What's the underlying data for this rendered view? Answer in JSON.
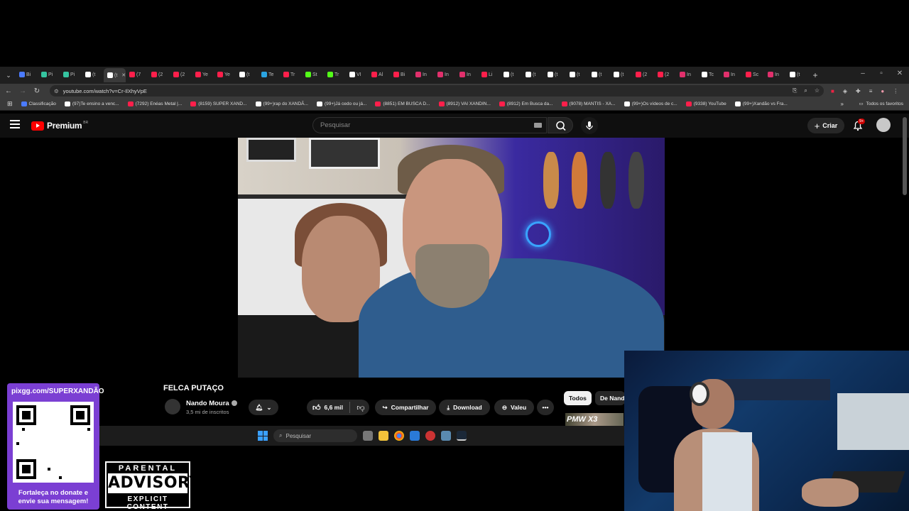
{
  "browser": {
    "tabs": [
      {
        "label": "Bi",
        "color": "#4b7bff"
      },
      {
        "label": "Pi",
        "color": "#35c4a0"
      },
      {
        "label": "Pi",
        "color": "#35c4a0"
      },
      {
        "label": "(t",
        "color": "#ffffff"
      },
      {
        "label": "(t",
        "color": "#ffffff",
        "active": true
      },
      {
        "label": "(7",
        "color": "#ff1f4b"
      },
      {
        "label": "(2",
        "color": "#ff1f4b"
      },
      {
        "label": "(2",
        "color": "#ff1f4b"
      },
      {
        "label": "Ye",
        "color": "#ff1f4b"
      },
      {
        "label": "Ye",
        "color": "#ff1f4b"
      },
      {
        "label": "(t",
        "color": "#ffffff"
      },
      {
        "label": "Te",
        "color": "#2aa3e0"
      },
      {
        "label": "Tr",
        "color": "#ff1f4b"
      },
      {
        "label": "St",
        "color": "#53fc18"
      },
      {
        "label": "Tr",
        "color": "#53fc18"
      },
      {
        "label": "VI",
        "color": "#ffffff"
      },
      {
        "label": "Al",
        "color": "#ff1f4b"
      },
      {
        "label": "Bi",
        "color": "#ff1f4b"
      },
      {
        "label": "In",
        "color": "#e1306c"
      },
      {
        "label": "In",
        "color": "#e1306c"
      },
      {
        "label": "In",
        "color": "#e1306c"
      },
      {
        "label": "Li",
        "color": "#ff1f4b"
      },
      {
        "label": "(t",
        "color": "#ffffff"
      },
      {
        "label": "(t",
        "color": "#ffffff"
      },
      {
        "label": "(t",
        "color": "#ffffff"
      },
      {
        "label": "(t",
        "color": "#ffffff"
      },
      {
        "label": "(t",
        "color": "#ffffff"
      },
      {
        "label": "(t",
        "color": "#ffffff"
      },
      {
        "label": "(2",
        "color": "#ff1f4b"
      },
      {
        "label": "(2",
        "color": "#ff1f4b"
      },
      {
        "label": "In",
        "color": "#e1306c"
      },
      {
        "label": "Tc",
        "color": "#ffffff"
      },
      {
        "label": "In",
        "color": "#e1306c"
      },
      {
        "label": "Sc",
        "color": "#ff1f4b"
      },
      {
        "label": "In",
        "color": "#e1306c"
      },
      {
        "label": "(t",
        "color": "#ffffff"
      }
    ],
    "url": "youtube.com/watch?v=Cr-IlXhyVpE",
    "bookmarks": [
      {
        "label": "Classificação",
        "color": "#4b7bff"
      },
      {
        "label": "(97)Te ensino a venc...",
        "color": "#ffffff"
      },
      {
        "label": "(7292) Enéas Metal |...",
        "color": "#ff1f4b"
      },
      {
        "label": "(8159) SUPER XAND...",
        "color": "#ff1f4b"
      },
      {
        "label": "(99+)rap do XANDÃ...",
        "color": "#ffffff"
      },
      {
        "label": "(99+)Já cedo ou já...",
        "color": "#ffffff"
      },
      {
        "label": "(8851) EM BUSCA D...",
        "color": "#ff1f4b"
      },
      {
        "label": "(8912) VAI XANDIN...",
        "color": "#ff1f4b"
      },
      {
        "label": "(8912) Em Busca da...",
        "color": "#ff1f4b"
      },
      {
        "label": "(9078) MANTIS - XA...",
        "color": "#ff1f4b"
      },
      {
        "label": "(99+)Os vídeos de c...",
        "color": "#ffffff"
      },
      {
        "label": "(9338) YouTube",
        "color": "#ff1f4b"
      },
      {
        "label": "(99+)Xandão vs Fra...",
        "color": "#ffffff"
      }
    ],
    "all_bookmarks": "Todos os favoritos"
  },
  "youtube": {
    "brand": "Premium",
    "region": "BR",
    "search_placeholder": "Pesquisar",
    "create_label": "Criar",
    "notif_badge": "9+",
    "video_title": "FELCA PUTAÇO",
    "channel_name": "Nando Moura",
    "subscribers": "3,5 mi de inscritos",
    "likes": "6,6 mil",
    "share": "Compartilhar",
    "download": "Download",
    "thanks": "Valeu",
    "chips": [
      "Todos",
      "De Nando"
    ]
  },
  "taskbar": {
    "search_placeholder": "Pesquisar"
  },
  "overlay": {
    "donate_url": "pixgg.com/SUPERXANDÃO",
    "donate_caption": "Fortaleça no donate e envie sua mensagem!",
    "advisory_top": "PARENTAL",
    "advisory_mid": "ADVISORY",
    "advisory_bottom": "EXPLICIT CONTENT",
    "ad_logo_text": "PMW X3"
  }
}
